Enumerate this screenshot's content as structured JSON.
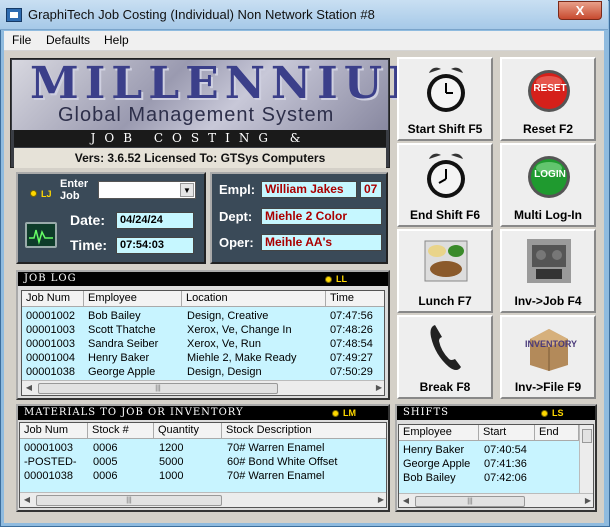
{
  "window": {
    "title": "GraphiTech Job Costing (Individual) Non Network Station #8",
    "close_label": "X"
  },
  "menu": [
    "File",
    "Defaults",
    "Help"
  ],
  "logo": {
    "main": "MILLENNIUM",
    "sub": "Global Management System",
    "strip": "JOB COSTING & TRACKING",
    "version_line": "Vers: 3.6.52   Licensed To: GTSys Computers"
  },
  "job_panel": {
    "led": "LJ",
    "enter_job_label": "Enter Job",
    "job_value": "",
    "date_label": "Date:",
    "date_value": "04/24/24",
    "time_label": "Time:",
    "time_value": "07:54:03"
  },
  "operator": {
    "empl_label": "Empl:",
    "empl_value": "William Jakes",
    "empl_id": "07",
    "dept_label": "Dept:",
    "dept_value": "Miehle 2 Color",
    "oper_label": "Oper:",
    "oper_value": "Meihle AA's"
  },
  "buttons": {
    "start_shift": "Start Shift F5",
    "reset": "Reset F2",
    "reset_icon_text": "RESET",
    "end_shift": "End Shift F6",
    "multi_login": "Multi Log-In",
    "login_icon_text": "LOGIN",
    "lunch": "Lunch F7",
    "inv_job": "Inv->Job F4",
    "break": "Break F8",
    "inv_file": "Inv->File F9",
    "inventory_icon_text": "INVENTORY"
  },
  "job_log": {
    "title": "JOB LOG",
    "led": "LL",
    "columns": [
      "Job Num",
      "Employee",
      "Location",
      "Time"
    ],
    "rows": [
      [
        "00001002",
        "Bob Bailey",
        "Design, Creative",
        "07:47:56"
      ],
      [
        "00001003",
        "Scott Thatche",
        "Xerox, Ve, Change In",
        "07:48:26"
      ],
      [
        "00001003",
        "Sandra Seiber",
        "Xerox, Ve, Run",
        "07:48:54"
      ],
      [
        "00001004",
        "Henry Baker",
        "Miehle 2, Make Ready",
        "07:49:27"
      ],
      [
        "00001038",
        "George Apple",
        "Design, Design",
        "07:50:29"
      ]
    ]
  },
  "materials": {
    "title": "MATERIALS TO JOB OR INVENTORY",
    "led": "LM",
    "columns": [
      "Job Num",
      "Stock #",
      "Quantity",
      "Stock Description"
    ],
    "rows": [
      [
        "00001003",
        "0006",
        "1200",
        "70# Warren Enamel"
      ],
      [
        "-POSTED-",
        "0005",
        "5000",
        "60# Bond White Offset"
      ],
      [
        "00001038",
        "0006",
        "1000",
        "70# Warren Enamel"
      ]
    ]
  },
  "shifts": {
    "title": "SHIFTS",
    "led": "LS",
    "columns": [
      "Employee",
      "Start",
      "End"
    ],
    "rows": [
      [
        "Henry Baker",
        "07:40:54",
        ""
      ],
      [
        "George Apple",
        "07:41:36",
        ""
      ],
      [
        "Bob Bailey",
        "07:42:06",
        ""
      ]
    ]
  },
  "colors": {
    "field_bg": "#c6f7ff",
    "field_text": "#aa0000",
    "led": "#ffd800",
    "panel": "#3a4a58"
  }
}
